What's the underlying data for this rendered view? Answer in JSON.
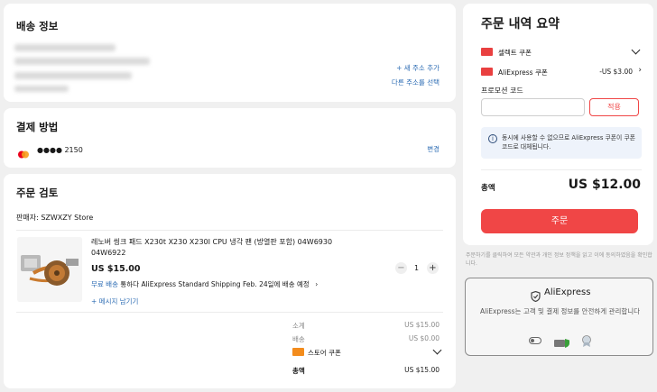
{
  "shipping": {
    "title": "배송 정보",
    "add_address": "+ 새 주소 추가",
    "choose_other": "다른 주소를 선택"
  },
  "payment": {
    "title": "결제 방법",
    "card_mask": "●●●● 2150",
    "change": "변경"
  },
  "review": {
    "title": "주문 검토",
    "seller": "판매자: SZWXZY Store",
    "product_title_line1": "레노버 씽크 패드 X230t X230 X230I CPU 냉각 팬 (방열판 포함) 04W6930",
    "product_title_line2": "04W6922",
    "price": "US $15.00",
    "qty": "1",
    "free_shipping": "무료 배송",
    "shipping_info": "통하다 AliExpress Standard Shipping Feb. 24일에 배송 예정",
    "leave_message": "+ 메시지 남기기",
    "subtotal_label": "소계",
    "subtotal_value": "US $15.00",
    "shipping_label": "배송",
    "shipping_value": "US $0.00",
    "store_coupon": "스토어 쿠폰",
    "total_label": "총액",
    "total_value": "US $15.00"
  },
  "summary": {
    "title": "주문 내역 요약",
    "select_coupon": "셀렉트 쿠폰",
    "ali_coupon": "AliExpress 쿠폰",
    "ali_coupon_value": "-US $3.00",
    "promo_label": "프로모션 코드",
    "promo_placeholder": "",
    "apply": "적용",
    "notice": "동시에 사용할 수 없으므로 AliExpress 쿠폰이 쿠폰 코드로 대체됩니다.",
    "total_label": "총액",
    "total_value": "US $12.00",
    "order_button": "주문"
  },
  "terms": "주문하기를 클릭하여 모든 약관과 개인 정보 정책을 읽고 이에 동의하였음을 확인합니다.",
  "trust": {
    "brand": "AliExpress",
    "text": "AliExpress는 고객 및 결제 정보를 안전하게 관리합니다"
  },
  "colors": {
    "accent": "#f04646",
    "link": "#2e6db4",
    "background": "#f0f0f0"
  }
}
